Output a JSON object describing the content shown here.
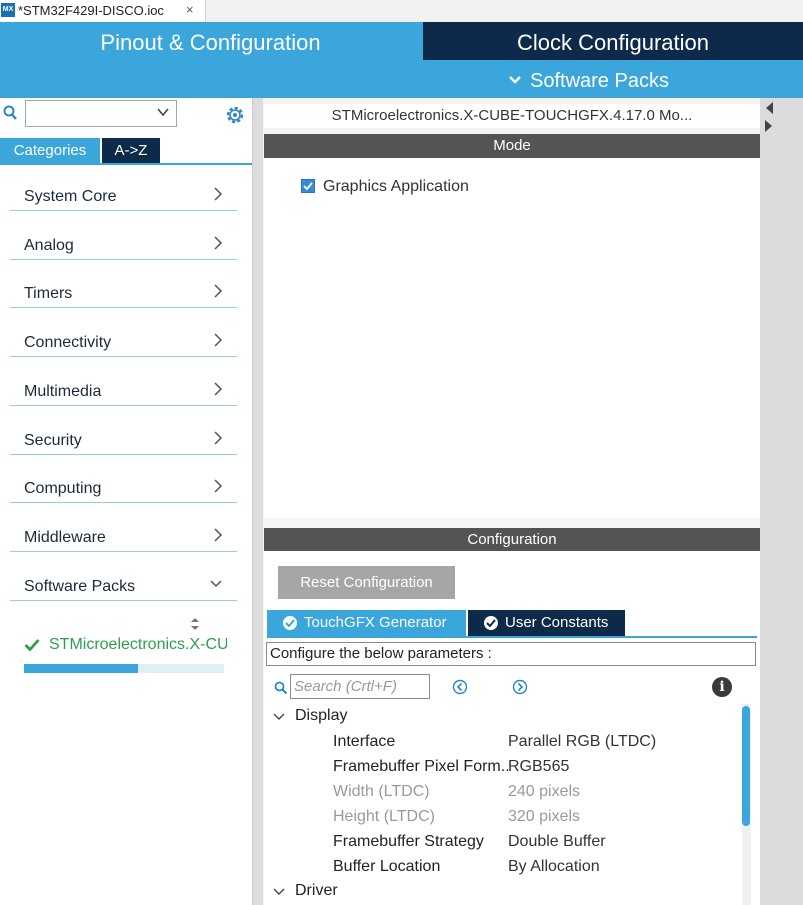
{
  "file_tab": {
    "icon_text": "MX",
    "name": "*STM32F429I-DISCO.ioc",
    "close_icon": "×"
  },
  "header": {
    "tab_pinout": "Pinout & Configuration",
    "tab_clock": "Clock Configuration",
    "menu_software_packs": "Software Packs",
    "accent": "#3aa6dc",
    "dark": "#0d2a4a"
  },
  "sidebar": {
    "search_value": "",
    "tab_categories": "Categories",
    "tab_az": "A->Z",
    "categories": [
      {
        "label": "System Core",
        "expanded": false
      },
      {
        "label": "Analog",
        "expanded": false
      },
      {
        "label": "Timers",
        "expanded": false
      },
      {
        "label": "Connectivity",
        "expanded": false
      },
      {
        "label": "Multimedia",
        "expanded": false
      },
      {
        "label": "Security",
        "expanded": false
      },
      {
        "label": "Computing",
        "expanded": false
      },
      {
        "label": "Middleware",
        "expanded": false
      },
      {
        "label": "Software Packs",
        "expanded": true
      }
    ],
    "pack_item": {
      "label": "STMicroelectronics.X-CUBE-TOUCHGFX",
      "progress": 0.57
    }
  },
  "center": {
    "pack_title": "STMicroelectronics.X-CUBE-TOUCHGFX.4.17.0 Mo...",
    "mode_header": "Mode",
    "mode_option": {
      "label": "Graphics Application",
      "checked": true
    },
    "config_header": "Configuration",
    "reset_button": "Reset Configuration",
    "tabs": [
      {
        "label": "TouchGFX Generator",
        "active": true
      },
      {
        "label": "User Constants",
        "active": false
      }
    ],
    "params_caption": "Configure the below parameters :",
    "search_placeholder": "Search (Crtl+F)",
    "info_icon": "i",
    "groups": [
      {
        "label": "Display",
        "params": [
          {
            "name": "Interface",
            "value": "Parallel RGB (LTDC)",
            "disabled": false
          },
          {
            "name": "Framebuffer Pixel Form..",
            "value": "RGB565",
            "disabled": false
          },
          {
            "name": "Width (LTDC)",
            "value": "240 pixels",
            "disabled": true
          },
          {
            "name": "Height (LTDC)",
            "value": "320 pixels",
            "disabled": true
          },
          {
            "name": "Framebuffer Strategy",
            "value": "Double Buffer",
            "disabled": false
          },
          {
            "name": "Buffer Location",
            "value": "By Allocation",
            "disabled": false
          }
        ]
      },
      {
        "label": "Driver",
        "params": []
      }
    ]
  }
}
